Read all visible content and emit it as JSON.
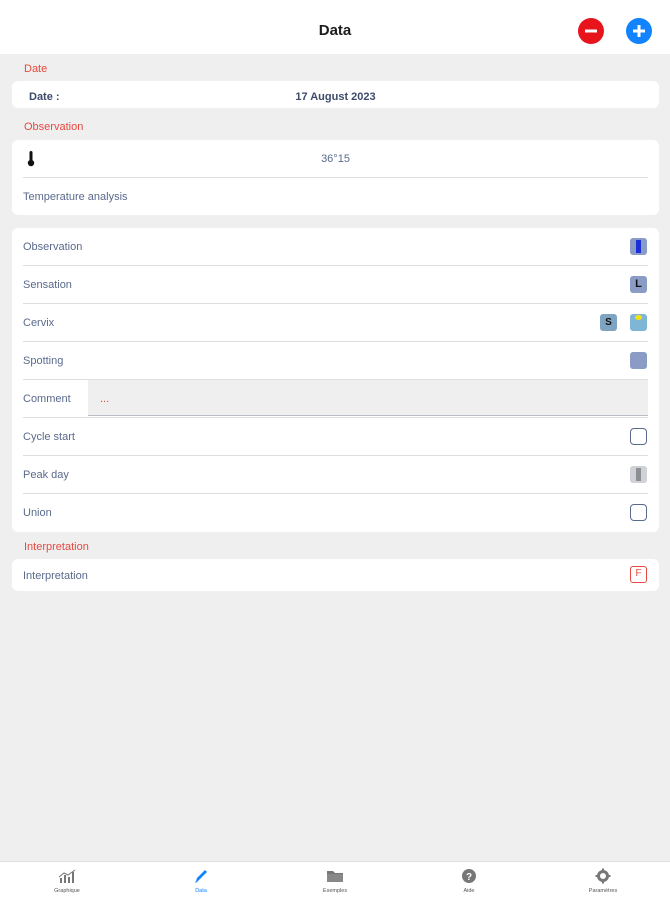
{
  "header": {
    "title": "Data"
  },
  "sections": {
    "date": "Date",
    "observation": "Observation",
    "interpretation": "Interpretation"
  },
  "date_row": {
    "label": "Date :",
    "value": "17 August 2023"
  },
  "temperature": {
    "value": "36°15",
    "analysis_label": "Temperature analysis"
  },
  "observations": {
    "observation": "Observation",
    "sensation": "Sensation",
    "sensation_badge": "L",
    "cervix": "Cervix",
    "cervix_badge": "S",
    "spotting": "Spotting",
    "comment": "Comment",
    "comment_value": "...",
    "cycle_start": "Cycle start",
    "peak_day": "Peak day",
    "union": "Union"
  },
  "interpretation": {
    "label": "Interpretation",
    "badge": "F"
  },
  "tabs": [
    {
      "label": "Graphique",
      "icon": "chart-icon"
    },
    {
      "label": "Data",
      "icon": "pencil-icon"
    },
    {
      "label": "Exemples",
      "icon": "folder-icon"
    },
    {
      "label": "Aide",
      "icon": "help-icon"
    },
    {
      "label": "Paramètres",
      "icon": "gear-icon"
    }
  ],
  "active_tab": "Data",
  "colors": {
    "accent": "#1283ff",
    "remove": "#e8141c",
    "section_label": "#e8483f",
    "text": "#5a6a8c",
    "background": "#efeff0"
  }
}
